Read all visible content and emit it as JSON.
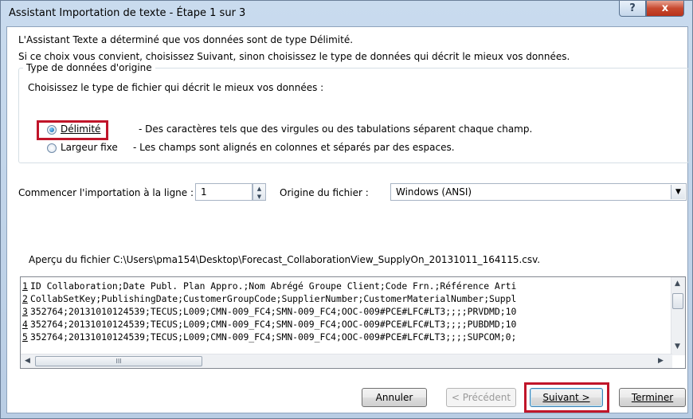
{
  "window": {
    "title": "Assistant Importation de texte - Étape 1 sur 3",
    "help_symbol": "?",
    "close_symbol": "x"
  },
  "intro": {
    "line1": "L'Assistant Texte a déterminé que vos données sont de type Délimité.",
    "line2": "Si ce choix vous convient, choisissez Suivant, sinon choisissez le type de données qui décrit le mieux vos données."
  },
  "data_type": {
    "group_title": "Type de données d'origine",
    "prompt": "Choisissez le type de fichier qui décrit le mieux vos données :",
    "options": [
      {
        "label": "Délimité",
        "description": "- Des caractères tels que des virgules ou des tabulations séparent chaque champ.",
        "selected": true
      },
      {
        "label": "Largeur fixe",
        "description": "- Les champs sont alignés en colonnes et séparés par des espaces.",
        "selected": false
      }
    ]
  },
  "start_row": {
    "label": "Commencer l'importation à la ligne :",
    "value": "1"
  },
  "file_origin": {
    "label": "Origine du fichier :",
    "value": "Windows (ANSI)"
  },
  "preview": {
    "label": "Aperçu du fichier C:\\Users\\pma154\\Desktop\\Forecast_CollaborationView_SupplyOn_20131011_164115.csv.",
    "lines": [
      {
        "num": "1",
        "text": "ID Collaboration;Date Publ. Plan Appro.;Nom Abrégé Groupe Client;Code Frn.;Référence Arti"
      },
      {
        "num": "2",
        "text": "CollabSetKey;PublishingDate;CustomerGroupCode;SupplierNumber;CustomerMaterialNumber;Suppl"
      },
      {
        "num": "3",
        "text": "352764;20131010124539;TECUS;L009;CMN-009_FC4;SMN-009_FC4;OOC-009#PCE#LFC#LT3;;;;PRVDMD;10"
      },
      {
        "num": "4",
        "text": "352764;20131010124539;TECUS;L009;CMN-009_FC4;SMN-009_FC4;OOC-009#PCE#LFC#LT3;;;;PUBDMD;10"
      },
      {
        "num": "5",
        "text": "352764;20131010124539;TECUS;L009;CMN-009_FC4;SMN-009_FC4;OOC-009#PCE#LFC#LT3;;;;SUPCOM;0;"
      }
    ],
    "hscroll_grip": "III"
  },
  "buttons": {
    "cancel": "Annuler",
    "previous": "< Précédent",
    "next": "Suivant >",
    "finish": "Terminer"
  },
  "colors": {
    "highlight": "#c0152a",
    "accent": "#0a5fa8"
  }
}
